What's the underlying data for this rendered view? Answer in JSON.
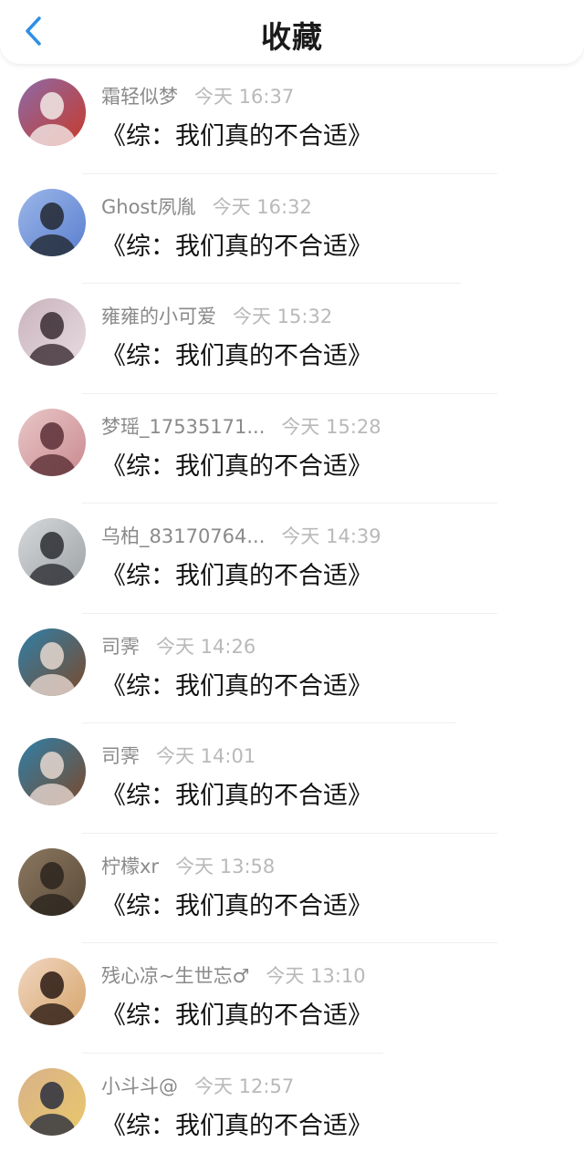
{
  "header": {
    "title": "收藏",
    "back_icon": "chevron-left-icon",
    "accent_color": "#2f8fe6"
  },
  "items": [
    {
      "user": "霜轻似梦",
      "time": "今天 16:37",
      "title": "《综：我们真的不合适》",
      "avatar_colors": [
        "#c83a2a",
        "#f2e9e6",
        "#8c6aa8"
      ]
    },
    {
      "user": "Ghost夙胤",
      "time": "今天 16:32",
      "title": "《综：我们真的不合适》",
      "avatar_colors": [
        "#5b7fd0",
        "#222831",
        "#9bb6e8"
      ]
    },
    {
      "user": "雍雍的小可爱",
      "time": "今天 15:32",
      "title": "《综：我们真的不合适》",
      "avatar_colors": [
        "#e7dbe0",
        "#3a2c32",
        "#c9b3bd"
      ]
    },
    {
      "user": "梦瑶_17535171...",
      "time": "今天 15:28",
      "title": "《综：我们真的不合适》",
      "avatar_colors": [
        "#c98a8f",
        "#5a2f36",
        "#e9c7c8"
      ]
    },
    {
      "user": "乌柏_83170764...",
      "time": "今天 14:39",
      "title": "《综：我们真的不合适》",
      "avatar_colors": [
        "#9ea3a6",
        "#2d2e33",
        "#d6d8da"
      ]
    },
    {
      "user": "司霁",
      "time": "今天 14:26",
      "title": "《综：我们真的不合适》",
      "avatar_colors": [
        "#7a4a2c",
        "#e6d7cf",
        "#2f7fa8"
      ]
    },
    {
      "user": "司霁",
      "time": "今天 14:01",
      "title": "《综：我们真的不合适》",
      "avatar_colors": [
        "#7a4a2c",
        "#e6d7cf",
        "#2f7fa8"
      ]
    },
    {
      "user": "柠檬xr",
      "time": "今天 13:58",
      "title": "《综：我们真的不合适》",
      "avatar_colors": [
        "#5a4b3a",
        "#2b241d",
        "#8b775f"
      ]
    },
    {
      "user": "残心凉~生世忘♂",
      "time": "今天 13:10",
      "title": "《综：我们真的不合适》",
      "avatar_colors": [
        "#d6a56a",
        "#2b1a14",
        "#f1d6c2"
      ]
    },
    {
      "user": "小斗斗@",
      "time": "今天 12:57",
      "title": "《综：我们真的不合适》",
      "avatar_colors": [
        "#e8c86a",
        "#2b2f3e",
        "#d9b18a"
      ]
    }
  ]
}
